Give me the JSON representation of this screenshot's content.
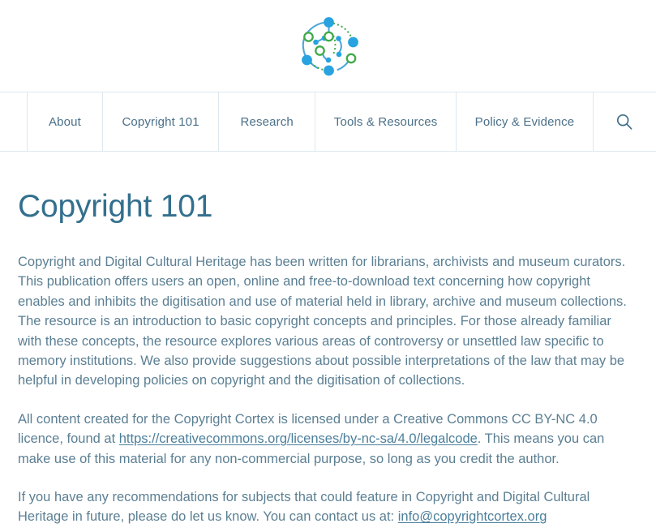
{
  "header": {
    "logo_icon": "network-nodes-logo",
    "logo_colors": {
      "blue": "#28a3e0",
      "green": "#3faa49",
      "link_blue": "#4da6d8"
    }
  },
  "nav": {
    "items": [
      {
        "label": "About",
        "icon": null
      },
      {
        "label": "Copyright 101",
        "icon": null
      },
      {
        "label": "Research",
        "icon": null
      },
      {
        "label": "Tools & Resources",
        "icon": null
      },
      {
        "label": "Policy & Evidence",
        "icon": null
      }
    ],
    "search": {
      "icon": "search-icon",
      "label": "Search"
    }
  },
  "main": {
    "title": "Copyright 101",
    "paragraphs": [
      {
        "id": "intro",
        "text": "Copyright and Digital Cultural Heritage has been written for librarians, archivists and museum curators. This publication offers users an open, online and free-to-download text concerning how copyright enables and inhibits the digitisation and use of material held in library, archive and museum collections. The resource is an introduction to basic copyright concepts and principles. For those already familiar with these concepts, the resource explores various areas of controversy or unsettled law specific to memory institutions. We also provide suggestions about possible interpretations of the law that may be helpful in developing policies on copyright and the digitisation of collections."
      },
      {
        "id": "licence",
        "before_link": "All content created for the Copyright Cortex is licensed under a Creative Commons CC BY-NC 4.0 licence, found at ",
        "link_text": "https://creativecommons.org/licenses/by-nc-sa/4.0/legalcode",
        "after_link": ". This means you can make use of this material for any non-commercial purpose, so long as you credit the author."
      },
      {
        "id": "contact",
        "before_link": "If you have any recommendations for subjects that could feature in Copyright and Digital Cultural Heritage in future, please do let us know. You can contact us at: ",
        "link_text": "info@copyrightcortex.org",
        "after_link": ""
      }
    ]
  },
  "colors": {
    "title": "#33708e",
    "body_text": "#5b7f93",
    "nav_text": "#4b7089",
    "link": "#4b7f9b",
    "border": "#dde8ee",
    "background": "#ffffff"
  }
}
